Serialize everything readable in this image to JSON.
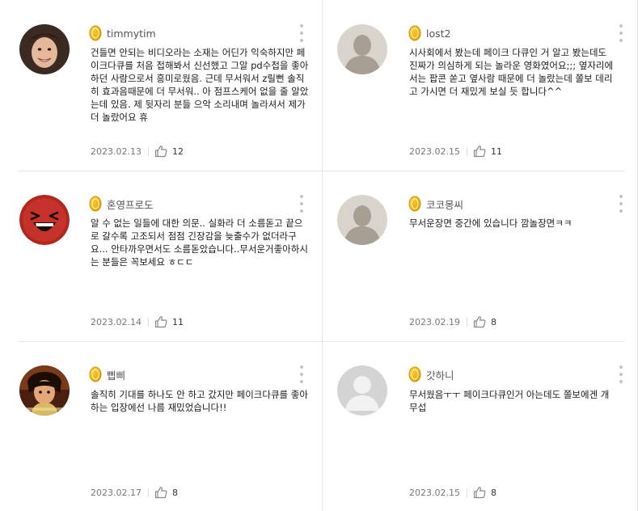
{
  "comments": [
    {
      "username": "timmytim",
      "avatar": "photo-young-man",
      "text": "건들면 안되는 비디오라는 소재는 어딘가 익숙하지만 페이크다큐를 처음 접해봐서 신선했고 그알 pd수첩을 좋아하던 사람으로서 흥미로웠음. 근데 무서워서 z릴뻔 솔직히 효과음때문에 더 무서워.. 아 점프스케어 없을 줄 알았는데 있음. 제 뒷자리 분들 으악 소리내며 놀라셔서 제가 더 놀랐어요 휴",
      "date": "2023.02.13",
      "likes": "12"
    },
    {
      "username": "lost2",
      "avatar": "default-silhouette",
      "text": "시사회에서 봤는데 페이크 다큐인 거 알고 봤는데도 진짜가 의심하게 되는 놀라운 영화였어요;;; 옆자리에서는 팝콘 쏟고 옆사람 때문에 더 놀랐는데 쫄보 데리고 가시면 더 재밌게 보실 듯 합니다^^",
      "date": "2023.02.15",
      "likes": "11"
    },
    {
      "username": "혼영프로도",
      "avatar": "red-laughing-face",
      "text": "알 수 없는 일들에 대한 의문.. 실화라 더 소름돋고 끝으로 갈수록 고조되서 점점 긴장감을 늦출수가 없더라구요... 안타까우면서도 소름돋았습니다..무서운거좋아하시는 분들은 꼭보세요 ㅎㄷㄷ",
      "date": "2023.02.14",
      "likes": "11"
    },
    {
      "username": "코코몽씨",
      "avatar": "default-silhouette",
      "text": "무서운장면 중간에 있습니다 깜놀장면ㅋㅋ",
      "date": "2023.02.19",
      "likes": "8"
    },
    {
      "username": "삡삐",
      "avatar": "anime-character",
      "text": "솔직히 기대를 하나도 안 하고 갔지만 페이크다큐를 좋아하는 입장에선 나름 재밌었습니다!!",
      "date": "2023.02.17",
      "likes": "8"
    },
    {
      "username": "갓하니",
      "avatar": "default-gray-silhouette",
      "text": "무서웠음ㅜㅜ 페이크다큐인거 아는데도 쫄보에겐 개무섭",
      "date": "2023.02.15",
      "likes": "8"
    }
  ],
  "icons": {
    "coin": "gold-coin-icon",
    "like": "thumbs-up-icon",
    "more": "more-vertical-icon"
  },
  "colors": {
    "coin": "#f2b705",
    "divider": "#e8e8e8",
    "date": "#777777"
  }
}
